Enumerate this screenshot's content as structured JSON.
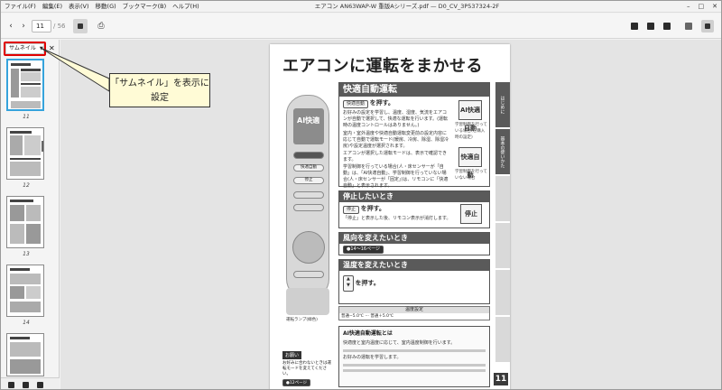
{
  "window": {
    "title": "エアコン AN63WAP-W 重版Aシリーズ.pdf — D0_CV_3P537324-2F",
    "controls": [
      "–",
      "□",
      "✕"
    ]
  },
  "menubar": [
    "ファイル(F)",
    "編集(E)",
    "表示(V)",
    "移動(G)",
    "ブックマーク(B)",
    "ヘルプ(H)"
  ],
  "toolbar": {
    "prev_glyph": "‹",
    "next_glyph": "›",
    "current_page": "11",
    "total_pages": "/ 56",
    "print_glyph": "⎙"
  },
  "sidebar": {
    "tab_label": "サムネイル",
    "tab_dropdown": "▼",
    "close_glyph": "✕",
    "thumbnails": [
      {
        "page": "11",
        "selected": true
      },
      {
        "page": "12",
        "selected": false
      },
      {
        "page": "13",
        "selected": false
      },
      {
        "page": "14",
        "selected": false
      },
      {
        "page": "",
        "selected": false
      }
    ]
  },
  "callout": {
    "line1": "「サムネイル」を表示に",
    "line2": "設定"
  },
  "page": {
    "title": "エアコンに運転をまかせる",
    "number": "11",
    "side_tabs": [
      "はじめに",
      "基本の使いかた",
      "",
      "",
      "",
      ""
    ],
    "remote": {
      "screen_text": "AI快適",
      "buttons": [
        "快適自動",
        "停止"
      ],
      "lamp_label": "運転ランプ(緑色)"
    },
    "sections": {
      "auto": {
        "heading": "快適自動運転",
        "key": "快適自動",
        "push": "を押す。",
        "intro": "お好みの設定を学習し、温度、湿度、気流をエアコンが自動で選択して、快適な運転を行います。(運転時の温度コントロールはありません。)",
        "bullets": [
          "室内・室外温度や快適自動運転変更前の設定内容に応じて自動で運転モード(暖房、冷房、除湿、除湿冷房)や設定温度が選択されます。",
          "エアコンが選択した運転モードは、表示で確認できます。",
          "学習制御を行っている場合(人・床センサーが「自動」は、「AI快適自動」、学習制御を行っていない場合(人・床センサーが「固定」)は、リモコンに「快適自動」と表示されます。"
        ],
        "ai_label": "AI快適自動",
        "ai_caption": "学習制御を行っている場合(ご購入時の設定)",
        "ai2_label": "快適自動",
        "ai2_caption": "学習制御を行っていない場合"
      },
      "stop": {
        "heading": "停止したいとき",
        "key": "停止",
        "push": "を押す。",
        "text": "「停止」と表示した後、リモコン表示が消灯します。",
        "box_label": "停止"
      },
      "wind": {
        "heading": "風向を変えたいとき",
        "ref": "●14〜16ページ"
      },
      "temp": {
        "heading": "温度を変えたいとき",
        "push": "を押す。",
        "table_title": "温度設定",
        "table_row": "普通−5.0℃ ⋯ 普通＋5.0℃"
      },
      "ai_info": {
        "heading": "AI快適自動運転とは",
        "bullets": [
          "快適度と室内温度に応じて、室内温度制御を行います。",
          "お好みの運転を学習します。"
        ]
      },
      "memo": {
        "heading": "お願い",
        "text": "お好みに合わないときは運転モードを変えてください。",
        "ref": "●12ページ"
      }
    }
  }
}
